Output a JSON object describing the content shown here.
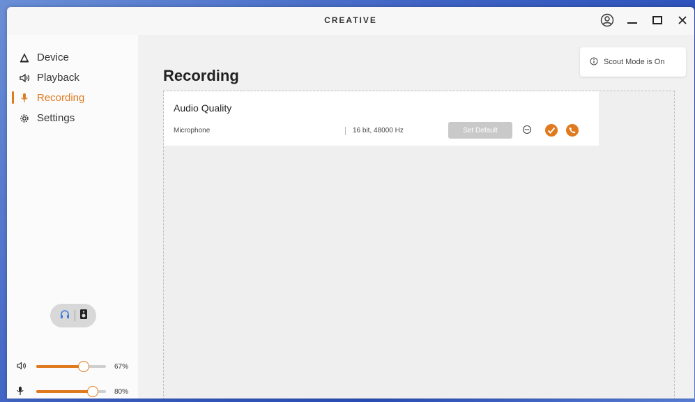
{
  "app": {
    "brand": "CREATIVE"
  },
  "sidebar": {
    "items": [
      {
        "label": "Device",
        "icon": "device-icon",
        "active": false
      },
      {
        "label": "Playback",
        "icon": "speaker-icon",
        "active": false
      },
      {
        "label": "Recording",
        "icon": "microphone-icon",
        "active": true
      },
      {
        "label": "Settings",
        "icon": "gear-icon",
        "active": false
      }
    ],
    "output_toggle": {
      "options": [
        "headphone-icon",
        "speaker-box-icon"
      ],
      "selected": "headphone-icon"
    },
    "playback_volume": {
      "value": 0.67,
      "label": "67%"
    },
    "mic_volume": {
      "value": 0.8,
      "label": "80%"
    }
  },
  "main": {
    "title": "Recording",
    "badge": "Scout Mode is On",
    "card": {
      "title": "Audio Quality",
      "row": {
        "label": "Microphone",
        "value": "16 bit, 48000 Hz",
        "set_default": "Set Default"
      }
    }
  },
  "colors": {
    "accent": "#e07a1f",
    "background": "#f1f1f1"
  }
}
